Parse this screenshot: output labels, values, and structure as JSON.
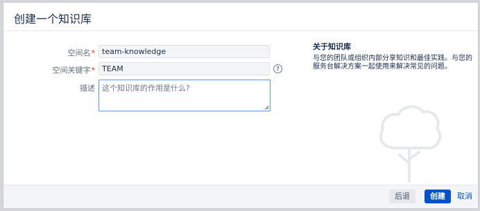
{
  "dialog": {
    "title": "创建一个知识库"
  },
  "form": {
    "space_name": {
      "label": "空间名",
      "required_mark": "*",
      "value": "team-knowledge"
    },
    "space_key": {
      "label": "空间关键字",
      "required_mark": "*",
      "value": "TEAM",
      "help_icon": "question-circle-icon"
    },
    "description": {
      "label": "描述",
      "placeholder": "这个知识库的作用是什么?"
    }
  },
  "info": {
    "title": "关于知识库",
    "text": "与您的团队或组织内部分享知识和最佳实践。与您的服务台解决方案一起使用来解决常见的问题。",
    "illustration_icon": "tree-icon"
  },
  "footer": {
    "back_label": "后退",
    "create_label": "创建",
    "cancel_label": "取消"
  },
  "colors": {
    "primary": "#0052cc",
    "required": "#de350b",
    "focus_border": "#4c9aff"
  }
}
